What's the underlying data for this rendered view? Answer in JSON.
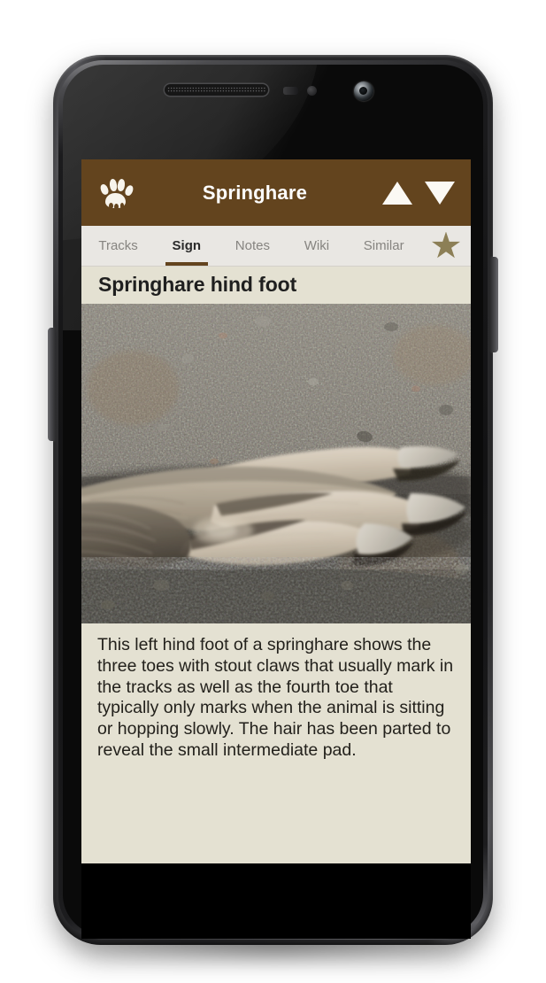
{
  "app": {
    "title": "Springhare",
    "paw_icon": "paw-print-icon",
    "nav": {
      "previous_icon": "triangle-up-icon",
      "next_icon": "triangle-down-icon"
    },
    "colors": {
      "action_bar": "#63441e",
      "tab_bar": "#e9e7e3",
      "content_background": "#e4e1d2",
      "active_tab_underline": "#63441e",
      "star": "#8c7f56",
      "body_text": "#23211c",
      "inactive_tab_text": "#868480"
    }
  },
  "tabs": [
    {
      "label": "Tracks",
      "active": false
    },
    {
      "label": "Sign",
      "active": true
    },
    {
      "label": "Notes",
      "active": false
    },
    {
      "label": "Wiki",
      "active": false
    },
    {
      "label": "Similar",
      "active": false
    }
  ],
  "favorite": {
    "icon": "star-icon",
    "selected": true
  },
  "content": {
    "heading": "Springhare hind foot",
    "photo_alt": "Close-up photograph of a springhare left hind foot with pale tan fur and claws lying on gravelly ground",
    "body": "This left hind foot of a springhare shows the three toes with stout claws that usually mark in the tracks as well as the fourth toe that typically only marks when the animal is sitting or hopping slowly. The hair has been parted to reveal the small intermediate pad."
  },
  "device": {
    "earpiece": "earpiece-speaker",
    "front_camera": "front-camera",
    "proximity_sensor": "proximity-sensor",
    "volume_button": "volume-rocker-button",
    "power_button": "power-button"
  }
}
